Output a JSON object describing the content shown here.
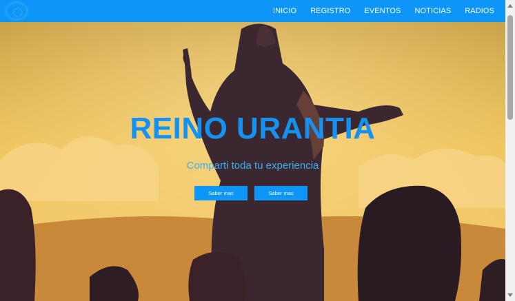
{
  "nav": {
    "items": [
      "INICIO",
      "REGISTRO",
      "EVENTOS",
      "NOTICIAS",
      "RADIOS"
    ]
  },
  "hero": {
    "title": "REINO URANTIA",
    "subtitle": "Comparti toda tu experiencia",
    "buttons": [
      "Saber mas",
      "Saber mas"
    ]
  },
  "colors": {
    "nav_bg": "#0d95f7",
    "title": "#1592ef",
    "subtitle": "#38b2f5"
  }
}
